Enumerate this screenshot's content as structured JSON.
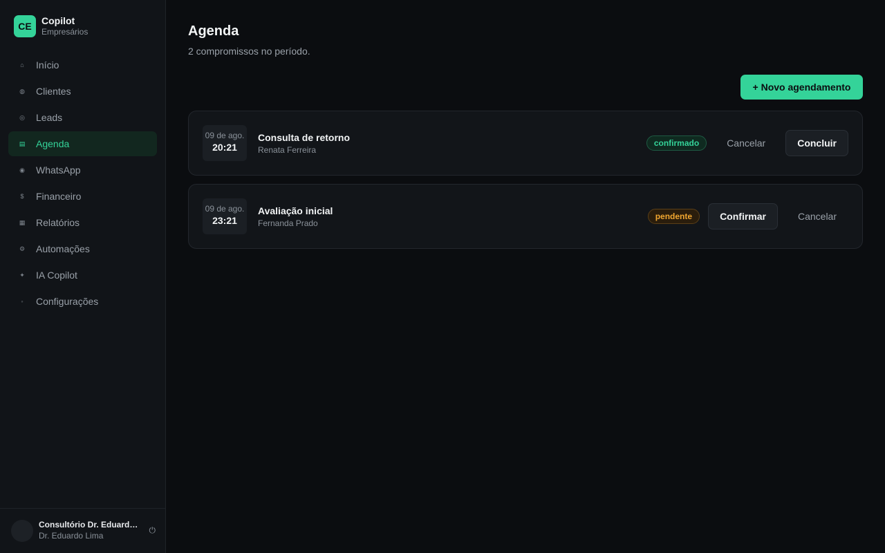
{
  "brand": {
    "logo": "CE",
    "title": "Copilot",
    "subtitle": "Empresários"
  },
  "sidebar": {
    "items": [
      {
        "label": "Início",
        "icon": "⌂",
        "icon_name": "home-icon"
      },
      {
        "label": "Clientes",
        "icon": "◍",
        "icon_name": "clients-icon"
      },
      {
        "label": "Leads",
        "icon": "◎",
        "icon_name": "target-icon"
      },
      {
        "label": "Agenda",
        "icon": "▤",
        "icon_name": "calendar-icon",
        "active": true
      },
      {
        "label": "WhatsApp",
        "icon": "◉",
        "icon_name": "chat-icon"
      },
      {
        "label": "Financeiro",
        "icon": "$",
        "icon_name": "dollar-icon"
      },
      {
        "label": "Relatórios",
        "icon": "▦",
        "icon_name": "report-icon"
      },
      {
        "label": "Automações",
        "icon": "⚙",
        "icon_name": "gear-icon"
      },
      {
        "label": "IA Copilot",
        "icon": "✦",
        "icon_name": "sparkle-icon"
      },
      {
        "label": "Configurações",
        "icon": "◦",
        "icon_name": "settings-icon"
      }
    ]
  },
  "user": {
    "name": "Consultório Dr. Eduardo Lima",
    "subtitle": "Dr. Eduardo Lima",
    "logout_icon": "⏻"
  },
  "page": {
    "title": "Agenda",
    "subtitle": "2 compromissos no período."
  },
  "toolbar": {
    "new_label": "+ Novo agendamento"
  },
  "appointments": [
    {
      "date": "09 de ago.",
      "time": "20:21",
      "title": "Consulta de retorno",
      "client": "Renata Ferreira",
      "status": "confirmado",
      "actions": [
        "Cancelar",
        "Concluir"
      ]
    },
    {
      "date": "09 de ago.",
      "time": "23:21",
      "title": "Avaliação inicial",
      "client": "Fernanda Prado",
      "status": "pendente",
      "actions": [
        "Confirmar",
        "Cancelar"
      ]
    }
  ],
  "colors": {
    "accent": "#34d399",
    "pending": "#f0a630",
    "background": "#0b0d10",
    "sidebar": "#111418"
  }
}
